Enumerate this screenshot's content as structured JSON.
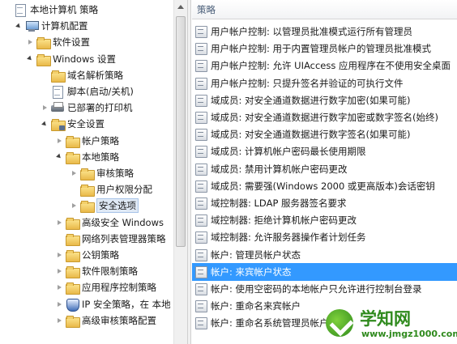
{
  "tree": {
    "items": [
      {
        "label": "本地计算机 策略",
        "icon": "doc-icon",
        "expander": "none"
      },
      {
        "label": "计算机配置",
        "icon": "computer-icon",
        "expander": "open"
      },
      {
        "label": "软件设置",
        "icon": "folder-icon",
        "expander": "closed"
      },
      {
        "label": "Windows 设置",
        "icon": "folder-icon",
        "expander": "open"
      },
      {
        "label": "域名解析策略",
        "icon": "folder-icon",
        "expander": "none"
      },
      {
        "label": "脚本(启动/关机)",
        "icon": "doc-icon",
        "expander": "none"
      },
      {
        "label": "已部署的打印机",
        "icon": "printer-icon",
        "expander": "closed"
      },
      {
        "label": "安全设置",
        "icon": "lock-folder-icon",
        "expander": "open"
      },
      {
        "label": "帐户策略",
        "icon": "folder-icon",
        "expander": "closed"
      },
      {
        "label": "本地策略",
        "icon": "folder-icon",
        "expander": "open"
      },
      {
        "label": "审核策略",
        "icon": "folder-icon",
        "expander": "closed"
      },
      {
        "label": "用户权限分配",
        "icon": "folder-icon",
        "expander": "none"
      },
      {
        "label": "安全选项",
        "icon": "folder-icon",
        "expander": "closed"
      },
      {
        "label": "高级安全 Windows",
        "icon": "folder-icon",
        "expander": "closed"
      },
      {
        "label": "网络列表管理器策略",
        "icon": "folder-icon",
        "expander": "none"
      },
      {
        "label": "公钥策略",
        "icon": "folder-icon",
        "expander": "closed"
      },
      {
        "label": "软件限制策略",
        "icon": "folder-icon",
        "expander": "closed"
      },
      {
        "label": "应用程序控制策略",
        "icon": "folder-icon",
        "expander": "closed"
      },
      {
        "label": "IP 安全策略，在 本地",
        "icon": "ip-shield-icon",
        "expander": "closed"
      },
      {
        "label": "高级审核策略配置",
        "icon": "folder-icon",
        "expander": "closed"
      }
    ],
    "selected_index": 12
  },
  "policies": {
    "column_header": "策略",
    "items": [
      "用户帐户控制: 以管理员批准模式运行所有管理员",
      "用户帐户控制: 用于内置管理员帐户的管理员批准模式",
      "用户帐户控制: 允许 UIAccess 应用程序在不使用安全桌面",
      "用户帐户控制: 只提升签名并验证的可执行文件",
      "域成员: 对安全通道数据进行数字加密(如果可能)",
      "域成员: 对安全通道数据进行数字加密或数字签名(始终)",
      "域成员: 对安全通道数据进行数字签名(如果可能)",
      "域成员: 计算机帐户密码最长使用期限",
      "域成员: 禁用计算机帐户密码更改",
      "域成员: 需要强(Windows 2000 或更高版本)会话密钥",
      "域控制器: LDAP 服务器签名要求",
      "域控制器: 拒绝计算机帐户密码更改",
      "域控制器: 允许服务器操作者计划任务",
      "帐户: 管理员帐户状态",
      "帐户: 来宾帐户状态",
      "帐户: 使用空密码的本地帐户只允许进行控制台登录",
      "帐户: 重命名来宾帐户",
      "帐户: 重命名系统管理员帐户"
    ],
    "selected_index": 14
  },
  "watermark": {
    "title": "学知网",
    "url": "www.jmgz1000.com"
  }
}
